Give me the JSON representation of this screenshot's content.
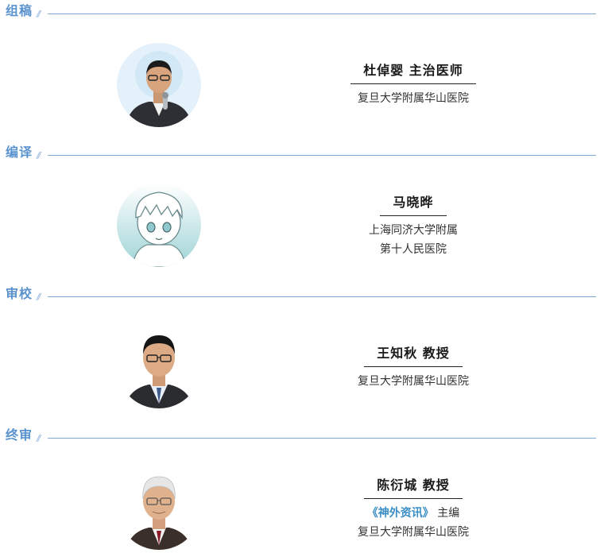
{
  "sections": [
    {
      "title": "组稿",
      "person": {
        "name": "杜倬婴 主治医师",
        "affiliation": [
          "复旦大学附属华山医院"
        ],
        "avatar_icon": "presenter-photo-icon"
      }
    },
    {
      "title": "编译",
      "person": {
        "name": "马晓晔",
        "affiliation": [
          "上海同济大学附属",
          "第十人民医院"
        ],
        "avatar_icon": "cartoon-avatar-icon"
      }
    },
    {
      "title": "审校",
      "person": {
        "name": "王知秋 教授",
        "affiliation": [
          "复旦大学附属华山医院"
        ],
        "avatar_icon": "portrait-photo-icon"
      }
    },
    {
      "title": "终审",
      "person": {
        "name": "陈衍城 教授",
        "journal": "《神外资讯》",
        "role": "主编",
        "affiliation": [
          "复旦大学附属华山医院"
        ],
        "avatar_icon": "senior-portrait-photo-icon"
      }
    }
  ],
  "colors": {
    "section_title": "#5b93cf",
    "divider": "#7fa9d6",
    "journal_accent": "#3a8ec6"
  }
}
